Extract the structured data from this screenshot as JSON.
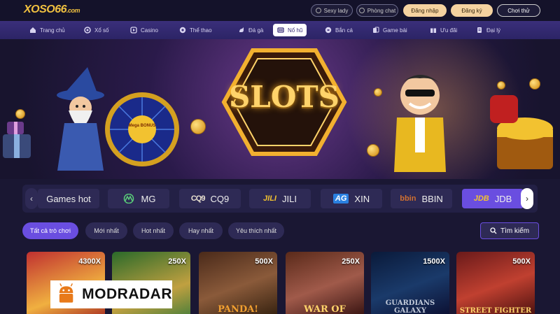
{
  "header": {
    "logo": "XOSO66",
    "logo_suffix": ".com",
    "buttons": {
      "sexy_lady": "Sexy lady",
      "chat_room": "Phòng chat",
      "login": "Đăng nhập",
      "register": "Đăng ký",
      "trial": "Chơi thử"
    }
  },
  "nav": {
    "items": [
      {
        "label": "Trang chủ",
        "icon": "home-icon"
      },
      {
        "label": "Xổ số",
        "icon": "lottery-icon"
      },
      {
        "label": "Casino",
        "icon": "casino-icon"
      },
      {
        "label": "Thể thao",
        "icon": "soccer-icon"
      },
      {
        "label": "Đá gà",
        "icon": "rooster-icon"
      },
      {
        "label": "Nổ hũ",
        "icon": "slot-icon",
        "active": true
      },
      {
        "label": "Bắn cá",
        "icon": "fish-icon"
      },
      {
        "label": "Game bài",
        "icon": "cards-icon"
      },
      {
        "label": "Ưu đãi",
        "icon": "gift-icon"
      },
      {
        "label": "Đại lý",
        "icon": "agent-icon"
      }
    ]
  },
  "banner": {
    "title": "SLOTS",
    "wheel_label": "Mega BONUS"
  },
  "providers": {
    "items": [
      {
        "label": "Games hot",
        "logo": ""
      },
      {
        "label": "MG",
        "logo": "mg-logo"
      },
      {
        "label": "CQ9",
        "logo_text": "CQ9"
      },
      {
        "label": "JILI",
        "logo_text": "JILI"
      },
      {
        "label": "XIN",
        "logo_text": "AG"
      },
      {
        "label": "BBIN",
        "logo_text": "bbin"
      },
      {
        "label": "JDB",
        "logo_text": "JDB",
        "active": true
      }
    ]
  },
  "filters": {
    "items": [
      {
        "label": "Tất cả trò chơi",
        "active": true
      },
      {
        "label": "Mới nhất"
      },
      {
        "label": "Hot nhất"
      },
      {
        "label": "Hay nhất"
      },
      {
        "label": "Yêu thích nhất"
      }
    ],
    "search_label": "Tìm kiếm"
  },
  "games": [
    {
      "multiplier": "4300X",
      "title": ""
    },
    {
      "multiplier": "250X",
      "title": ""
    },
    {
      "multiplier": "500X",
      "title": "PANDA!"
    },
    {
      "multiplier": "250X",
      "title": "WAR OF"
    },
    {
      "multiplier": "1500X",
      "title": "GUARDIANS GALAXY"
    },
    {
      "multiplier": "500X",
      "title": "STREET FIGHTER"
    }
  ],
  "watermark": {
    "text": "MODRADAR"
  },
  "colors": {
    "accent": "#6a4ee0",
    "nav_bg": "#3a2f7a",
    "gold": "#ffd36a",
    "login_bg": "#f5d2a0"
  }
}
